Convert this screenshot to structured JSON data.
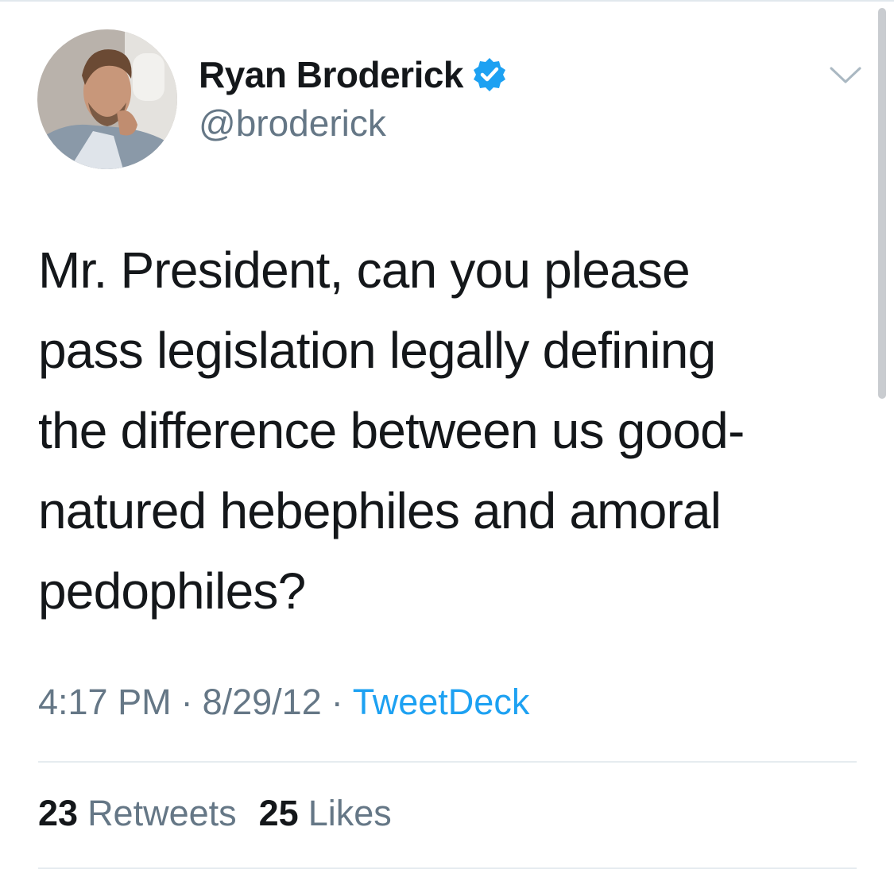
{
  "user": {
    "display_name": "Ryan Broderick",
    "handle": "@broderick",
    "verified": true
  },
  "tweet": {
    "text_lines": [
      "Mr. President, can you please",
      "pass legislation legally defining",
      "the difference between us good-",
      "natured hebephiles and amoral",
      "pedophiles?"
    ],
    "time": "4:17 PM",
    "date": "8/29/12",
    "separator": "·",
    "source": "TweetDeck"
  },
  "stats": {
    "retweets_count": "23",
    "retweets_label": "Retweets",
    "likes_count": "25",
    "likes_label": "Likes"
  },
  "icons": {
    "verified": "verified-badge-icon",
    "menu": "chevron-down-icon"
  },
  "colors": {
    "text": "#14171a",
    "secondary": "#657786",
    "accent": "#1da1f2",
    "divider": "#e6ecf0"
  }
}
